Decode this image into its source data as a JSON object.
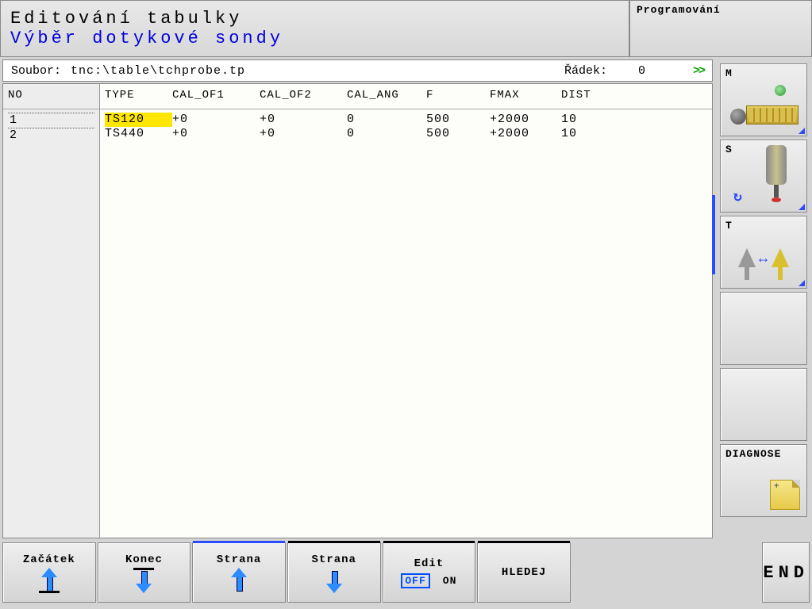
{
  "header": {
    "title1": "Editování tabulky",
    "title2": "Výběr dotykové sondy",
    "mode": "Programování"
  },
  "filebar": {
    "label": "Soubor:",
    "path": "tnc:\\table\\tchprobe.tp",
    "rowLabel": "Řádek:",
    "rowValue": "0",
    "chevrons": ">>"
  },
  "columns": {
    "no": "NO",
    "type": "TYPE",
    "cal_of1": "CAL_OF1",
    "cal_of2": "CAL_OF2",
    "cal_ang": "CAL_ANG",
    "f": "F",
    "fmax": "FMAX",
    "dist": "DIST"
  },
  "rows": [
    {
      "no": "1",
      "type": "TS120",
      "cal_of1": "+0",
      "cal_of2": "+0",
      "cal_ang": "0",
      "f": "500",
      "fmax": "+2000",
      "dist": "10"
    },
    {
      "no": "2",
      "type": "TS440",
      "cal_of1": "+0",
      "cal_of2": "+0",
      "cal_ang": "0",
      "f": "500",
      "fmax": "+2000",
      "dist": "10"
    }
  ],
  "side": {
    "m": "M",
    "s": "S",
    "t": "T",
    "diagnose": "DIAGNOSE"
  },
  "softkeys": {
    "begin": "Začátek",
    "end": "Konec",
    "pageUp": "Strana",
    "pageDown": "Strana",
    "edit": "Edit",
    "off": "OFF",
    "on": "ON",
    "search": "HLEDEJ",
    "END": "END"
  }
}
